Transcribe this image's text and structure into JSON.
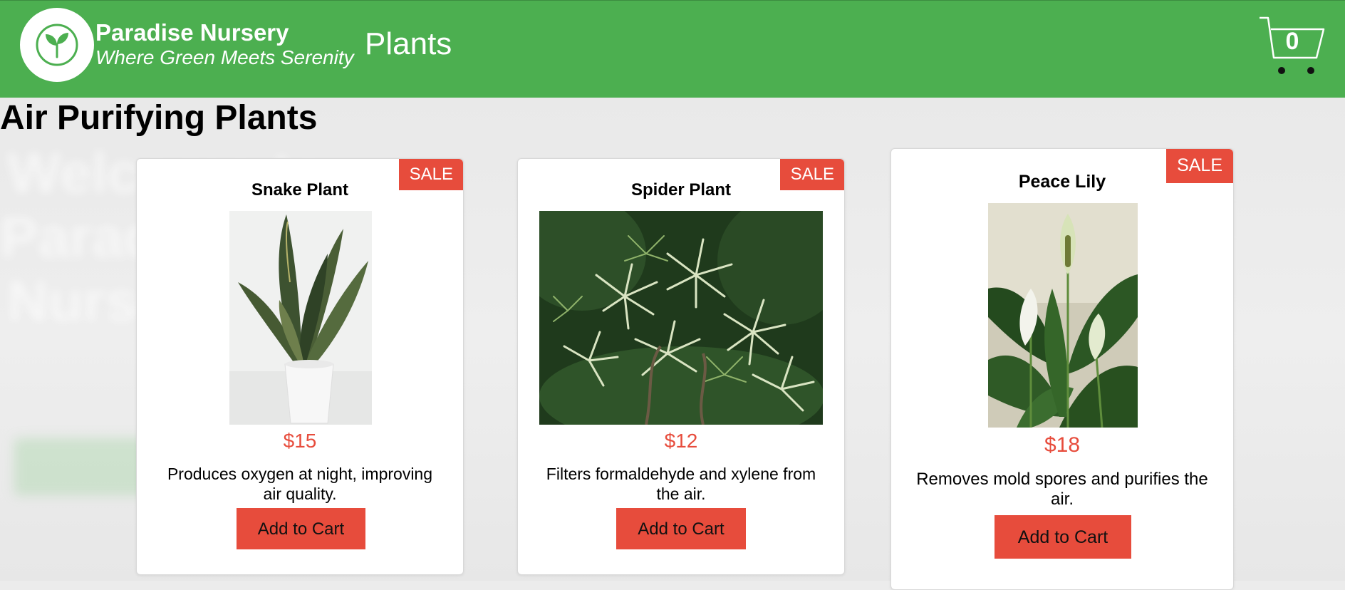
{
  "header": {
    "brand_name": "Paradise Nursery",
    "tagline": "Where Green Meets Serenity",
    "nav_link": "Plants",
    "cart_count": "0",
    "logo_icon": "seedling-icon",
    "cart_icon": "shopping-cart-icon"
  },
  "section": {
    "title": "Air Purifying Plants"
  },
  "products": [
    {
      "name": "Snake Plant",
      "badge": "SALE",
      "price": "$15",
      "description": "Produces oxygen at night, improving air quality.",
      "button": "Add to Cart"
    },
    {
      "name": "Spider Plant",
      "badge": "SALE",
      "price": "$12",
      "description": "Filters formaldehyde and xylene from the air.",
      "button": "Add to Cart"
    },
    {
      "name": "Peace Lily",
      "badge": "SALE",
      "price": "$18",
      "description": "Removes mold spores and purifies the air.",
      "button": "Add to Cart"
    }
  ],
  "colors": {
    "header_bg": "#4caf50",
    "accent_red": "#e74c3c",
    "card_bg": "#ffffff",
    "page_bg": "#ececec"
  }
}
